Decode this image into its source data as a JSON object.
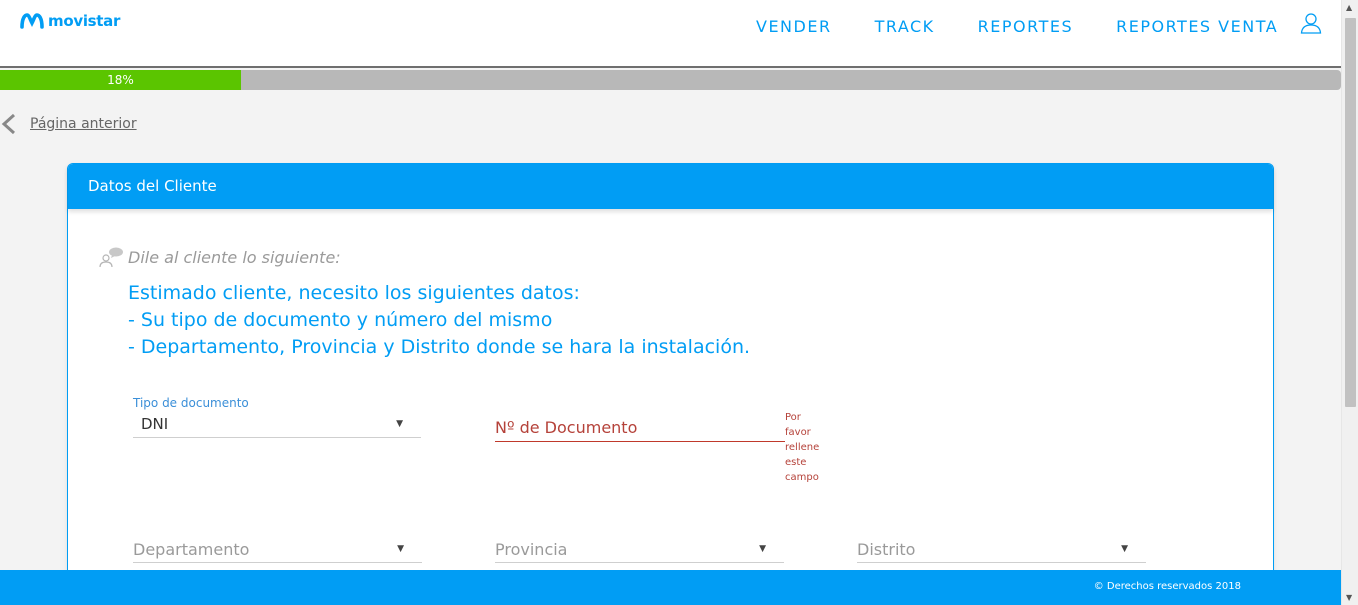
{
  "brand": {
    "logo_text": "movistar",
    "accent": "#019df4",
    "success": "#5bc500",
    "error": "#b5423a"
  },
  "nav": {
    "items": [
      "VENDER",
      "TRACK",
      "REPORTES",
      "REPORTES VENTA"
    ],
    "user_icon": "user-icon"
  },
  "progress": {
    "percent": 18,
    "label": "18%"
  },
  "back": {
    "label": "Página anterior",
    "icon": "chevron-left-icon"
  },
  "card": {
    "title": "Datos del Cliente",
    "say_label": "Dile al cliente lo siguiente:",
    "say_icon": "speech-person-icon",
    "script_lines": [
      "Estimado cliente, necesito los siguientes datos:",
      "- Su tipo de documento y número del mismo",
      "- Departamento, Provincia y Distrito donde se hara la instalación."
    ]
  },
  "form": {
    "doc_type": {
      "label": "Tipo de documento",
      "value": "DNI"
    },
    "doc_number": {
      "placeholder": "Nº de Documento",
      "error_lines": [
        "Por",
        "favor",
        "rellene",
        "este",
        "campo"
      ]
    },
    "departamento": {
      "placeholder": "Departamento"
    },
    "provincia": {
      "placeholder": "Provincia"
    },
    "distrito": {
      "placeholder": "Distrito"
    }
  },
  "footer": {
    "text": "© Derechos reservados 2018"
  }
}
